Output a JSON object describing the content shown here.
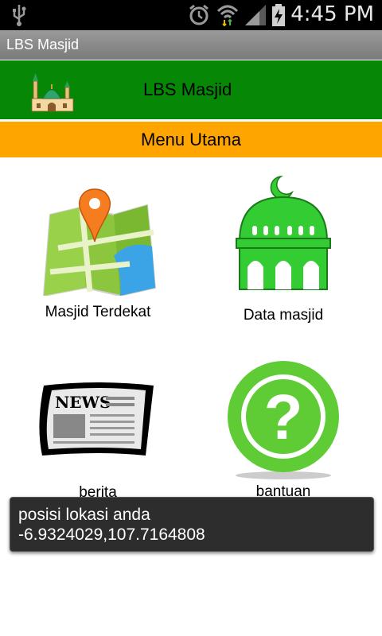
{
  "status_bar": {
    "time": "4:45 PM"
  },
  "app_title": "LBS Masjid",
  "header": {
    "title": "LBS Masjid"
  },
  "menu": {
    "title": "Menu Utama",
    "items": [
      {
        "label": "Masjid Terdekat",
        "icon": "map-pin-icon"
      },
      {
        "label": "Data masjid",
        "icon": "mosque-icon"
      },
      {
        "label": "berita",
        "icon": "newspaper-icon"
      },
      {
        "label": "bantuan",
        "icon": "help-icon"
      }
    ]
  },
  "toast": {
    "line1": "posisi lokasi anda",
    "line2": "-6.9324029,107.7164808"
  },
  "colors": {
    "header": "#068806",
    "menu_bar": "#ffa500",
    "help_green": "#5fcc36",
    "mosque_green": "#33cc33"
  }
}
